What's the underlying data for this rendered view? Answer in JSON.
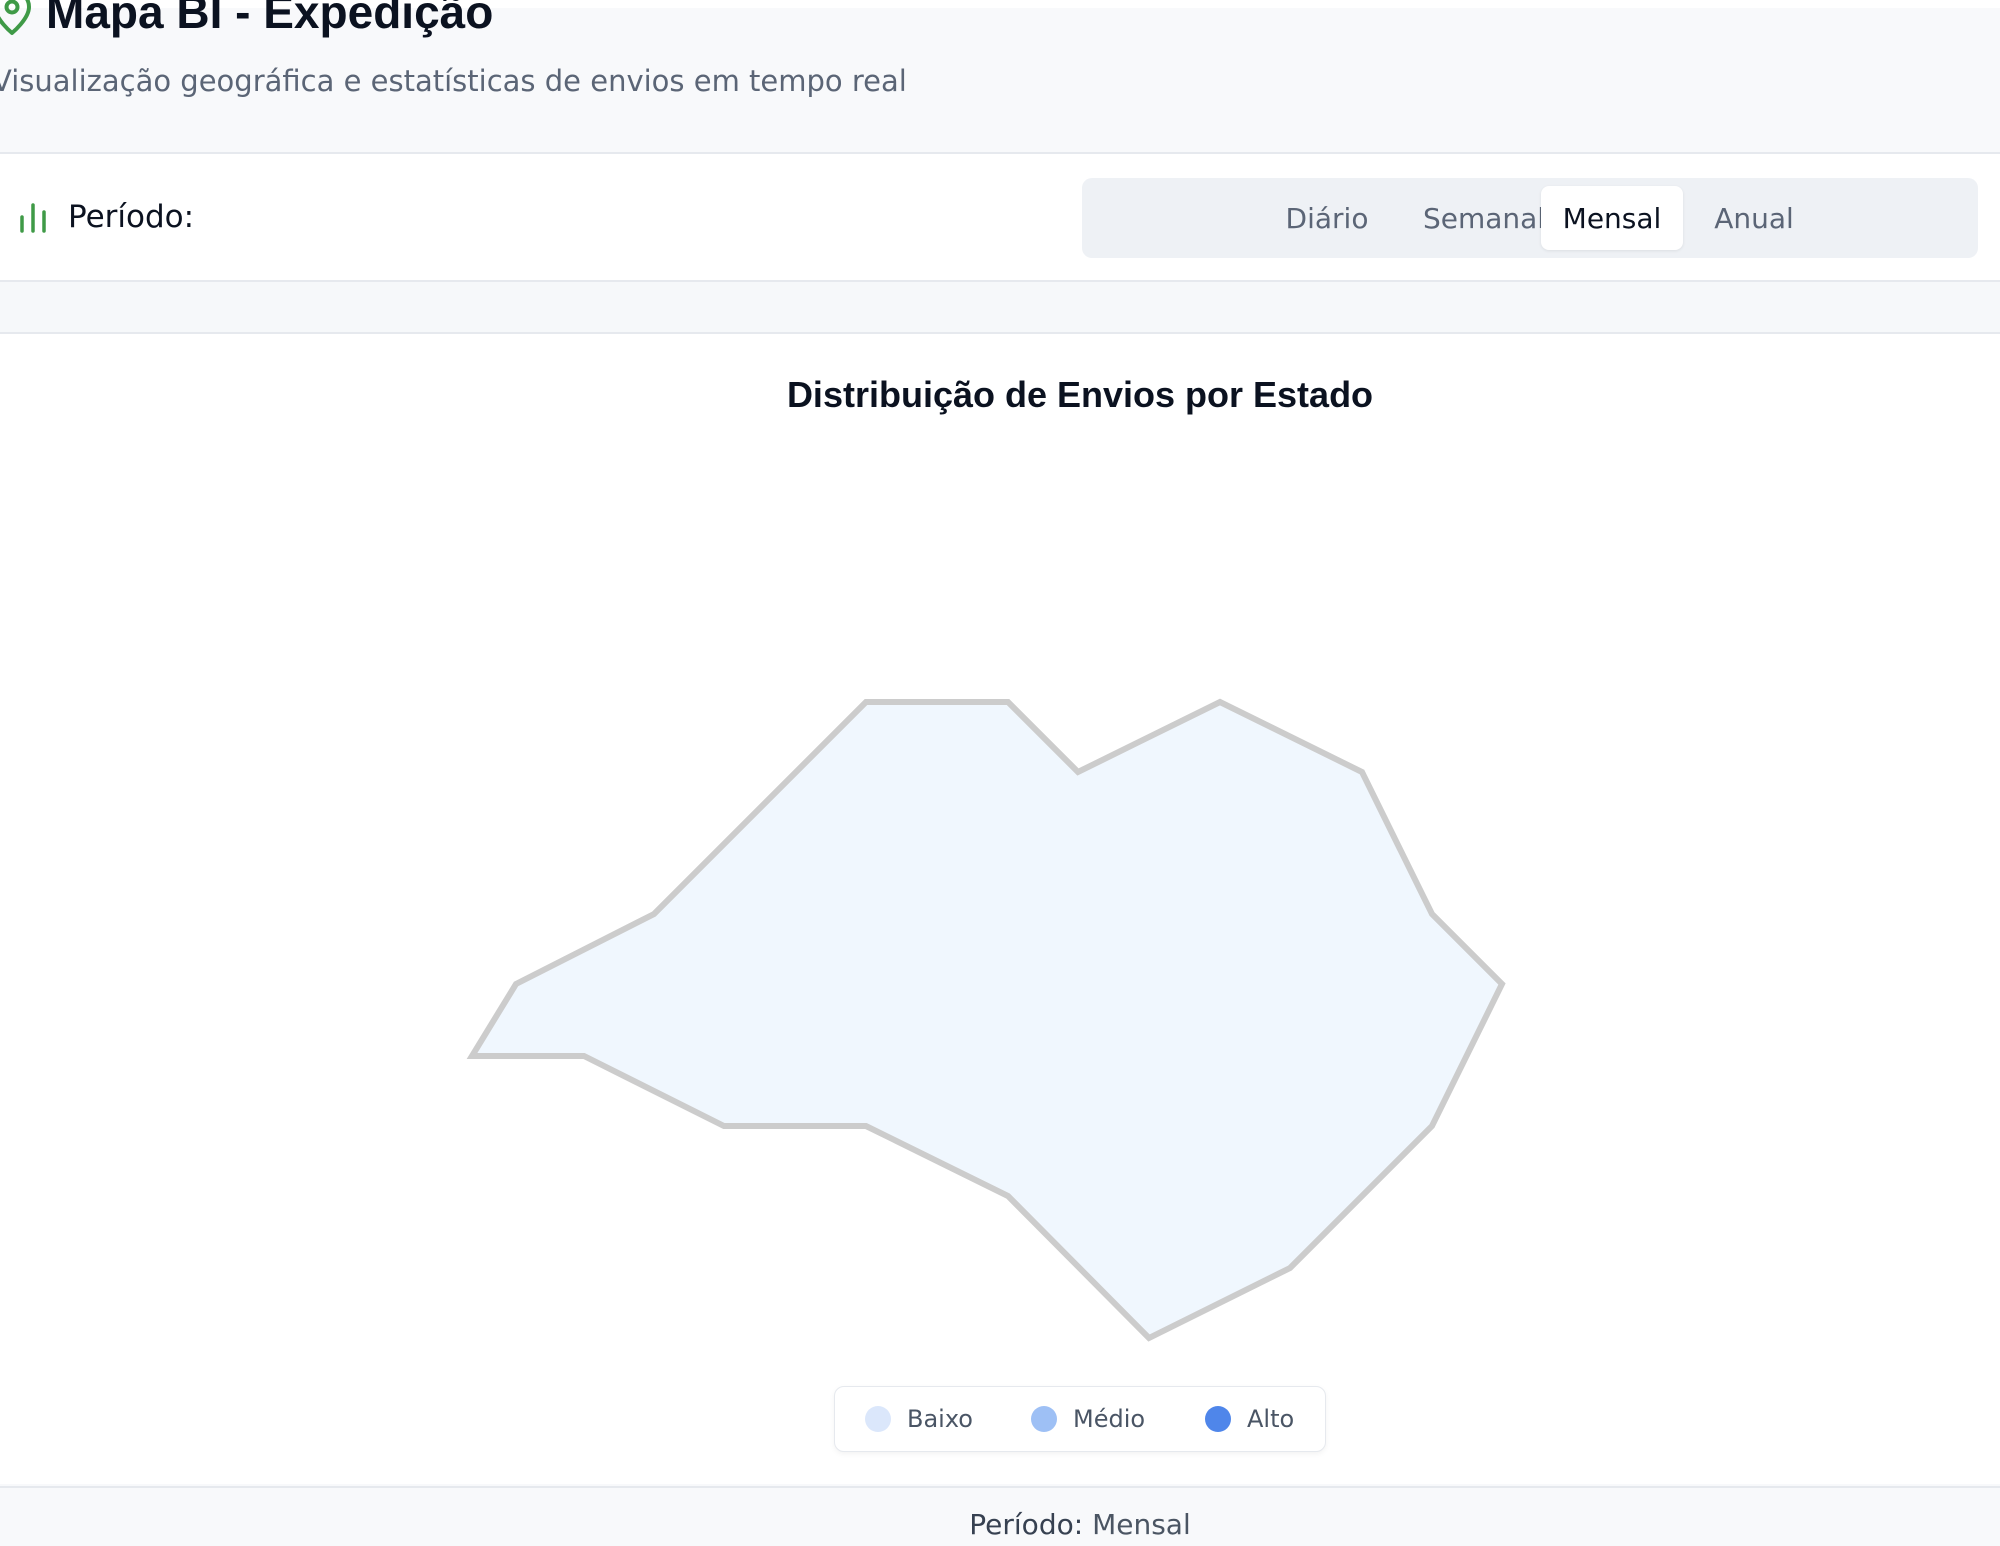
{
  "header": {
    "title": "Mapa BI - Expedição",
    "subtitle": "Visualização geográfica e estatísticas de envios em tempo real"
  },
  "period_selector": {
    "label": "Período:",
    "options": [
      "Diário",
      "Semanal",
      "Mensal",
      "Anual"
    ],
    "selected": "Mensal"
  },
  "map": {
    "title": "Distribuição de Envios por Estado",
    "region_fill": "#f0f7fe",
    "region_stroke": "#cccccc"
  },
  "legend": {
    "items": [
      {
        "label": "Baixo",
        "color": "#dbe7fb"
      },
      {
        "label": "Médio",
        "color": "#9ec0f5"
      },
      {
        "label": "Alto",
        "color": "#4f86ea"
      }
    ]
  },
  "footer": {
    "label": "Período:",
    "value": "Mensal"
  },
  "colors": {
    "accent_green": "#3f9a47",
    "text_primary": "#0b1220",
    "text_muted": "#5b6576"
  }
}
